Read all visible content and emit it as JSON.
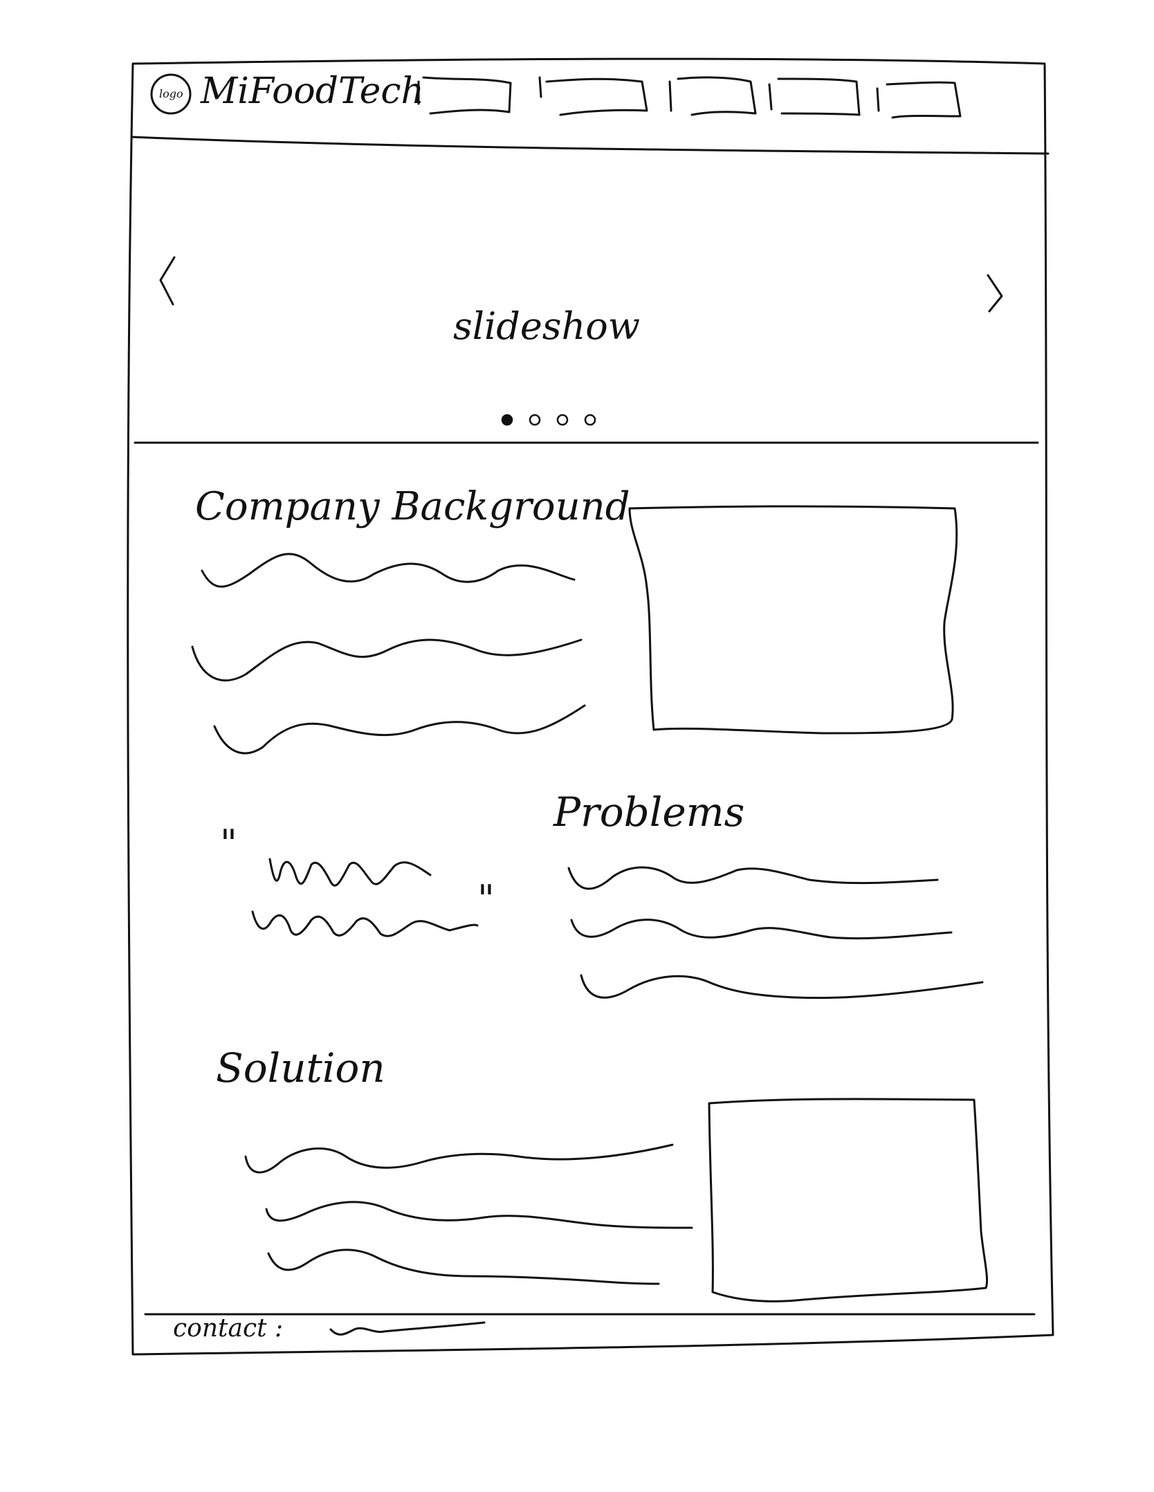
{
  "header": {
    "logo_text": "logo",
    "brand": "MiFoodTech",
    "nav_item_count_note": ""
  },
  "slideshow": {
    "label": "slideshow",
    "prev": "‹",
    "next": "›",
    "dots": [
      true,
      false,
      false,
      false
    ]
  },
  "sections": {
    "company_background": {
      "title": "Company Background"
    },
    "quote": {
      "open": "\"",
      "close": "\""
    },
    "problems": {
      "title": "Problems"
    },
    "solution": {
      "title": "Solution"
    }
  },
  "footer": {
    "contact_label": "contact :"
  }
}
